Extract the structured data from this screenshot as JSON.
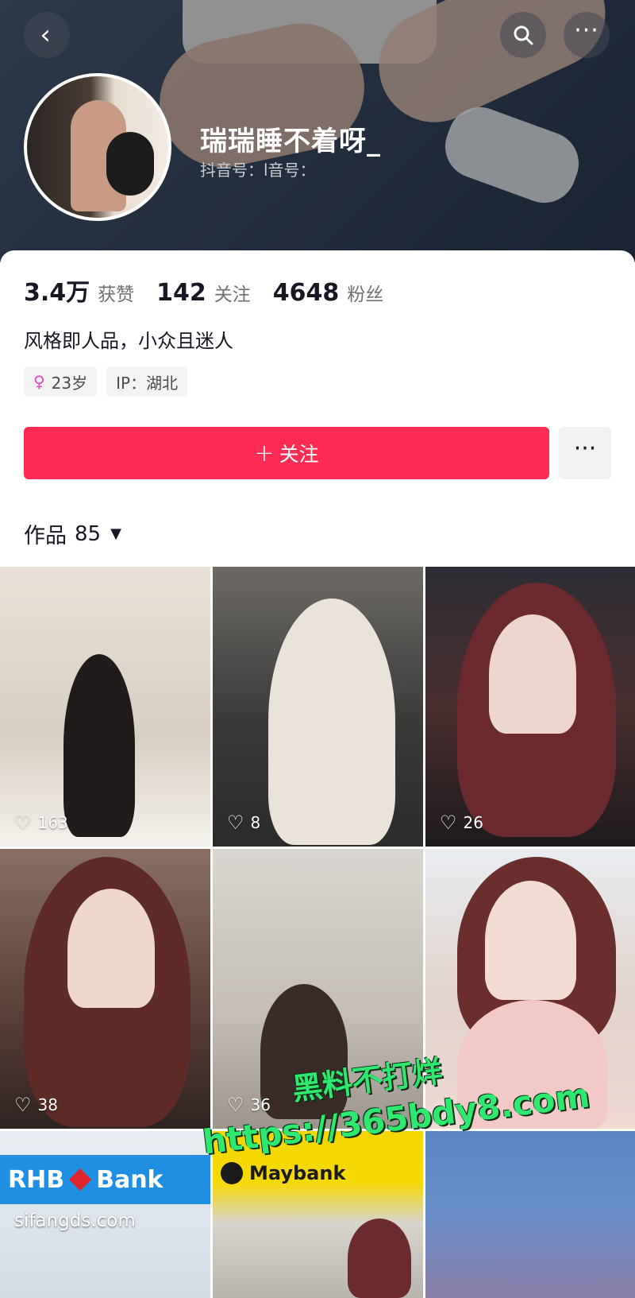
{
  "profile": {
    "username": "瑞瑞睡不着呀_",
    "douyin_id": "抖音号：l音号："
  },
  "stats": [
    {
      "value": "3.4万",
      "label": "获赞"
    },
    {
      "value": "142",
      "label": "关注"
    },
    {
      "value": "4648",
      "label": "粉丝"
    }
  ],
  "bio": "风格即人品，小众且迷人",
  "tags": {
    "age": "23岁",
    "ip": "IP：湖北"
  },
  "actions": {
    "follow_label": "关注",
    "follow_plus": "+",
    "more": "···"
  },
  "works": {
    "label": "作品",
    "count": "85",
    "caret": "▼"
  },
  "grid_likes": [
    "163",
    "8",
    "26",
    "38",
    "36"
  ],
  "signage": {
    "rhb": "RHB",
    "bank": "Bank",
    "maybank": "Maybank",
    "sifang": "sifangds.com"
  },
  "watermark": {
    "line1": "黑料不打烊",
    "line2": "https://365bdy8.com"
  },
  "colors": {
    "follow": "#fe2c55",
    "watermark": "#2ee86f"
  },
  "icons": {
    "back": "chevron-left-icon",
    "search": "search-icon",
    "more": "more-horizontal-icon",
    "gender": "female-icon",
    "heart": "heart-outline-icon"
  }
}
